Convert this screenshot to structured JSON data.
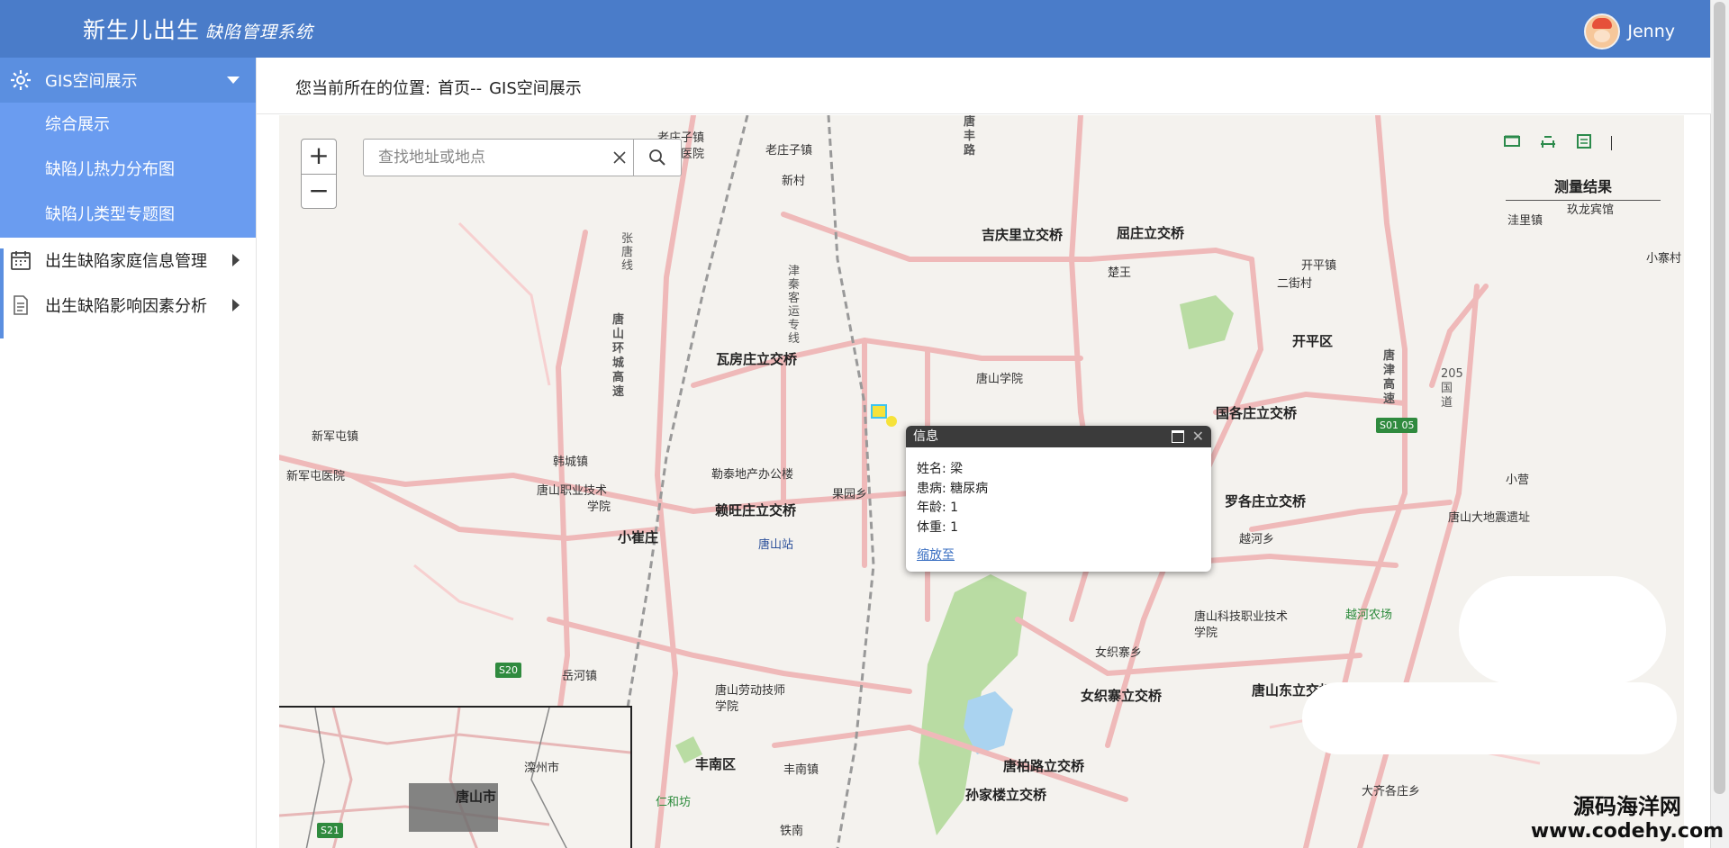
{
  "header": {
    "app_title": "新生儿出生",
    "app_subtitle": "缺陷管理系统",
    "user_name": "Jenny"
  },
  "sidebar": {
    "groups": [
      {
        "label": "GIS空间展示",
        "expanded": true,
        "children": [
          {
            "label": "综合展示"
          },
          {
            "label": "缺陷儿热力分布图"
          },
          {
            "label": "缺陷儿类型专题图"
          }
        ]
      },
      {
        "label": "出生缺陷家庭信息管理",
        "expanded": false
      },
      {
        "label": "出生缺陷影响因素分析",
        "expanded": false
      }
    ]
  },
  "breadcrumb": {
    "prefix": "您当前所在的位置:",
    "home": "首页--",
    "current": "GIS空间展示"
  },
  "map": {
    "search_placeholder": "查找地址或地点",
    "zoom_in": "+",
    "zoom_out": "−",
    "measure_title": "测量结果",
    "labels": [
      "老庄子镇",
      "中心医院",
      "老庄子镇",
      "新村",
      "吉庆里立交桥",
      "屈庄立交桥",
      "楚王",
      "开平镇",
      "二街村",
      "开平区",
      "瓦房庄立交桥",
      "唐山学院",
      "国各庄立交桥",
      "新军屯镇",
      "新军屯医院",
      "韩城镇",
      "唐山职业技术",
      "学院",
      "勒泰地产办公楼",
      "果园乡",
      "赖旺庄立交桥",
      "唐山站",
      "罗各庄立交桥",
      "越河乡",
      "小崔庄",
      "小营",
      "唐山大地震遗址",
      "唐山科技职业技术",
      "学院",
      "越河农场",
      "女织寨乡",
      "女织寨立交桥",
      "唐山东立交桥",
      "唐山劳动技师",
      "学院",
      "岳河镇",
      "丰南区",
      "丰南镇",
      "唐柏路立交桥",
      "孙家楼立交桥",
      "仁和坊",
      "铁南",
      "大齐各庄乡",
      "洼里镇",
      "玖龙宾馆",
      "小寨村",
      "唐山环城高速",
      "唐津高速",
      "205国道",
      "津秦客运专线",
      "唐丰路",
      "张唐线"
    ],
    "road_shields": [
      "S20",
      "S01 05"
    ]
  },
  "popup": {
    "title": "信息",
    "fields": [
      "姓名: 梁",
      "患病: 糖尿病",
      "年龄: 1",
      "体重: 1"
    ],
    "zoom_link": "缩放至"
  },
  "overview": {
    "labels": [
      "滦州市",
      "唐山市"
    ],
    "shield": "S21"
  },
  "watermark": {
    "line1": "源码海洋网",
    "line2": "www.codehy.com"
  }
}
